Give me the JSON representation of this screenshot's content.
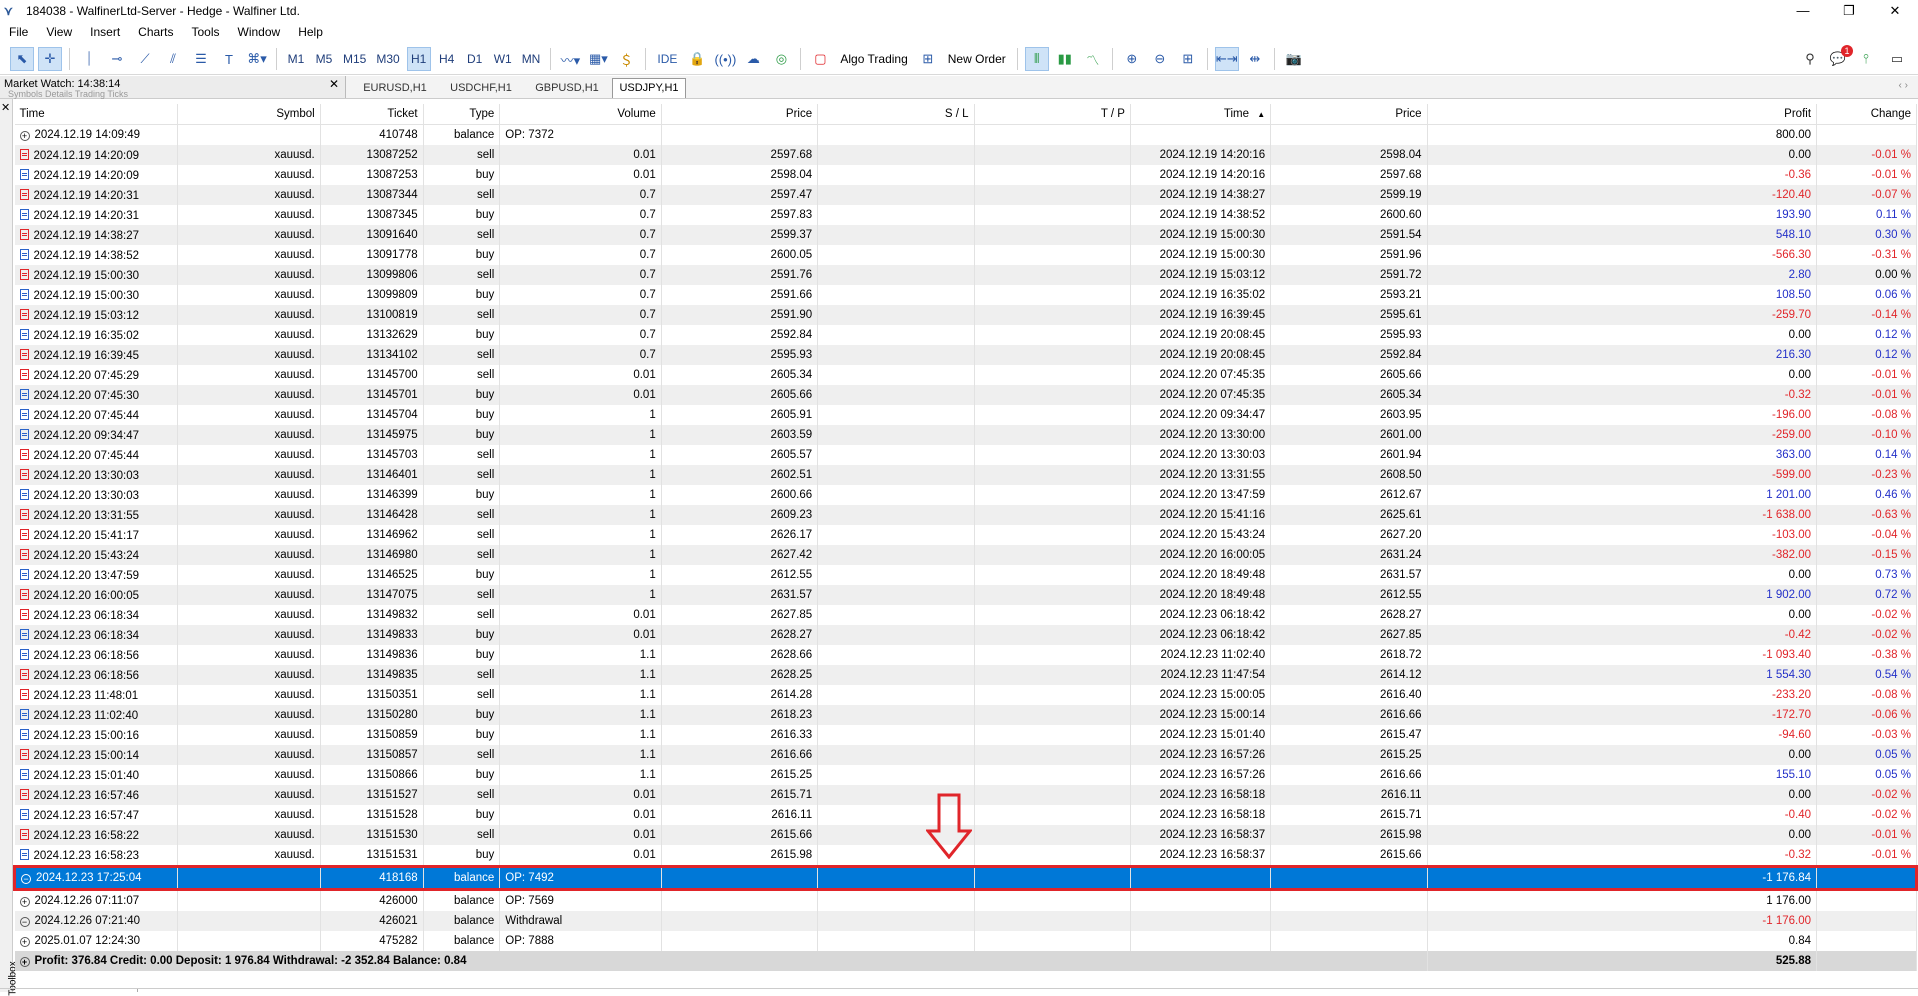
{
  "window": {
    "title": "184038 - WalfinerLtd-Server - Hedge - Walfiner Ltd."
  },
  "menu": [
    "File",
    "View",
    "Insert",
    "Charts",
    "Tools",
    "Window",
    "Help"
  ],
  "toolbar": {
    "timeframes": [
      "M1",
      "M5",
      "M15",
      "M30",
      "H1",
      "H4",
      "D1",
      "W1",
      "MN"
    ],
    "active_timeframe": "H1",
    "ide_label": "IDE",
    "algo_label": "Algo Trading",
    "neworder_label": "New Order",
    "notification_count": "1"
  },
  "market_watch": {
    "label": "Market Watch: 14:38:14",
    "ghost_tabs": "Symbols   Details   Trading   Ticks"
  },
  "chart_tabs": [
    "EURUSD,H1",
    "USDCHF,H1",
    "GBPUSD,H1",
    "USDJPY,H1"
  ],
  "active_chart_tab": "USDJPY,H1",
  "side_label": "Toolbox",
  "columns": [
    "Time",
    "Symbol",
    "Ticket",
    "Type",
    "Volume",
    "Price",
    "S / L",
    "T / P",
    "Time",
    "Price",
    "Profit",
    "Change"
  ],
  "rows": [
    {
      "kind": "balance",
      "time": "2024.12.19 14:09:49",
      "symbol": "",
      "ticket": "410748",
      "type": "balance",
      "volume": "OP: 7372",
      "price": "",
      "sl": "",
      "tp": "",
      "time2": "",
      "price2": "",
      "profit": "800.00",
      "change": ""
    },
    {
      "kind": "sell",
      "time": "2024.12.19 14:20:09",
      "symbol": "xauusd.",
      "ticket": "13087252",
      "type": "sell",
      "volume": "0.01",
      "price": "2597.68",
      "sl": "",
      "tp": "",
      "time2": "2024.12.19 14:20:16",
      "price2": "2598.04",
      "profit": "0.00",
      "change": "-0.01 %"
    },
    {
      "kind": "buy",
      "time": "2024.12.19 14:20:09",
      "symbol": "xauusd.",
      "ticket": "13087253",
      "type": "buy",
      "volume": "0.01",
      "price": "2598.04",
      "sl": "",
      "tp": "",
      "time2": "2024.12.19 14:20:16",
      "price2": "2597.68",
      "profit": "-0.36",
      "change": "-0.01 %"
    },
    {
      "kind": "sell",
      "time": "2024.12.19 14:20:31",
      "symbol": "xauusd.",
      "ticket": "13087344",
      "type": "sell",
      "volume": "0.7",
      "price": "2597.47",
      "sl": "",
      "tp": "",
      "time2": "2024.12.19 14:38:27",
      "price2": "2599.19",
      "profit": "-120.40",
      "change": "-0.07 %"
    },
    {
      "kind": "buy",
      "time": "2024.12.19 14:20:31",
      "symbol": "xauusd.",
      "ticket": "13087345",
      "type": "buy",
      "volume": "0.7",
      "price": "2597.83",
      "sl": "",
      "tp": "",
      "time2": "2024.12.19 14:38:52",
      "price2": "2600.60",
      "profit": "193.90",
      "change": "0.11 %"
    },
    {
      "kind": "sell",
      "time": "2024.12.19 14:38:27",
      "symbol": "xauusd.",
      "ticket": "13091640",
      "type": "sell",
      "volume": "0.7",
      "price": "2599.37",
      "sl": "",
      "tp": "",
      "time2": "2024.12.19 15:00:30",
      "price2": "2591.54",
      "profit": "548.10",
      "change": "0.30 %"
    },
    {
      "kind": "buy",
      "time": "2024.12.19 14:38:52",
      "symbol": "xauusd.",
      "ticket": "13091778",
      "type": "buy",
      "volume": "0.7",
      "price": "2600.05",
      "sl": "",
      "tp": "",
      "time2": "2024.12.19 15:00:30",
      "price2": "2591.96",
      "profit": "-566.30",
      "change": "-0.31 %"
    },
    {
      "kind": "sell",
      "time": "2024.12.19 15:00:30",
      "symbol": "xauusd.",
      "ticket": "13099806",
      "type": "sell",
      "volume": "0.7",
      "price": "2591.76",
      "sl": "",
      "tp": "",
      "time2": "2024.12.19 15:03:12",
      "price2": "2591.72",
      "profit": "2.80",
      "change": "0.00 %"
    },
    {
      "kind": "buy",
      "time": "2024.12.19 15:00:30",
      "symbol": "xauusd.",
      "ticket": "13099809",
      "type": "buy",
      "volume": "0.7",
      "price": "2591.66",
      "sl": "",
      "tp": "",
      "time2": "2024.12.19 16:35:02",
      "price2": "2593.21",
      "profit": "108.50",
      "change": "0.06 %"
    },
    {
      "kind": "sell",
      "time": "2024.12.19 15:03:12",
      "symbol": "xauusd.",
      "ticket": "13100819",
      "type": "sell",
      "volume": "0.7",
      "price": "2591.90",
      "sl": "",
      "tp": "",
      "time2": "2024.12.19 16:39:45",
      "price2": "2595.61",
      "profit": "-259.70",
      "change": "-0.14 %"
    },
    {
      "kind": "buy",
      "time": "2024.12.19 16:35:02",
      "symbol": "xauusd.",
      "ticket": "13132629",
      "type": "buy",
      "volume": "0.7",
      "price": "2592.84",
      "sl": "",
      "tp": "",
      "time2": "2024.12.19 20:08:45",
      "price2": "2595.93",
      "profit": "0.00",
      "change": "0.12 %"
    },
    {
      "kind": "sell",
      "time": "2024.12.19 16:39:45",
      "symbol": "xauusd.",
      "ticket": "13134102",
      "type": "sell",
      "volume": "0.7",
      "price": "2595.93",
      "sl": "",
      "tp": "",
      "time2": "2024.12.19 20:08:45",
      "price2": "2592.84",
      "profit": "216.30",
      "change": "0.12 %"
    },
    {
      "kind": "sell",
      "time": "2024.12.20 07:45:29",
      "symbol": "xauusd.",
      "ticket": "13145700",
      "type": "sell",
      "volume": "0.01",
      "price": "2605.34",
      "sl": "",
      "tp": "",
      "time2": "2024.12.20 07:45:35",
      "price2": "2605.66",
      "profit": "0.00",
      "change": "-0.01 %"
    },
    {
      "kind": "buy",
      "time": "2024.12.20 07:45:30",
      "symbol": "xauusd.",
      "ticket": "13145701",
      "type": "buy",
      "volume": "0.01",
      "price": "2605.66",
      "sl": "",
      "tp": "",
      "time2": "2024.12.20 07:45:35",
      "price2": "2605.34",
      "profit": "-0.32",
      "change": "-0.01 %"
    },
    {
      "kind": "buy",
      "time": "2024.12.20 07:45:44",
      "symbol": "xauusd.",
      "ticket": "13145704",
      "type": "buy",
      "volume": "1",
      "price": "2605.91",
      "sl": "",
      "tp": "",
      "time2": "2024.12.20 09:34:47",
      "price2": "2603.95",
      "profit": "-196.00",
      "change": "-0.08 %"
    },
    {
      "kind": "buy",
      "time": "2024.12.20 09:34:47",
      "symbol": "xauusd.",
      "ticket": "13145975",
      "type": "buy",
      "volume": "1",
      "price": "2603.59",
      "sl": "",
      "tp": "",
      "time2": "2024.12.20 13:30:00",
      "price2": "2601.00",
      "profit": "-259.00",
      "change": "-0.10 %"
    },
    {
      "kind": "sell",
      "time": "2024.12.20 07:45:44",
      "symbol": "xauusd.",
      "ticket": "13145703",
      "type": "sell",
      "volume": "1",
      "price": "2605.57",
      "sl": "",
      "tp": "",
      "time2": "2024.12.20 13:30:03",
      "price2": "2601.94",
      "profit": "363.00",
      "change": "0.14 %"
    },
    {
      "kind": "sell",
      "time": "2024.12.20 13:30:03",
      "symbol": "xauusd.",
      "ticket": "13146401",
      "type": "sell",
      "volume": "1",
      "price": "2602.51",
      "sl": "",
      "tp": "",
      "time2": "2024.12.20 13:31:55",
      "price2": "2608.50",
      "profit": "-599.00",
      "change": "-0.23 %"
    },
    {
      "kind": "buy",
      "time": "2024.12.20 13:30:03",
      "symbol": "xauusd.",
      "ticket": "13146399",
      "type": "buy",
      "volume": "1",
      "price": "2600.66",
      "sl": "",
      "tp": "",
      "time2": "2024.12.20 13:47:59",
      "price2": "2612.67",
      "profit": "1 201.00",
      "change": "0.46 %"
    },
    {
      "kind": "sell",
      "time": "2024.12.20 13:31:55",
      "symbol": "xauusd.",
      "ticket": "13146428",
      "type": "sell",
      "volume": "1",
      "price": "2609.23",
      "sl": "",
      "tp": "",
      "time2": "2024.12.20 15:41:16",
      "price2": "2625.61",
      "profit": "-1 638.00",
      "change": "-0.63 %"
    },
    {
      "kind": "sell",
      "time": "2024.12.20 15:41:17",
      "symbol": "xauusd.",
      "ticket": "13146962",
      "type": "sell",
      "volume": "1",
      "price": "2626.17",
      "sl": "",
      "tp": "",
      "time2": "2024.12.20 15:43:24",
      "price2": "2627.20",
      "profit": "-103.00",
      "change": "-0.04 %"
    },
    {
      "kind": "sell",
      "time": "2024.12.20 15:43:24",
      "symbol": "xauusd.",
      "ticket": "13146980",
      "type": "sell",
      "volume": "1",
      "price": "2627.42",
      "sl": "",
      "tp": "",
      "time2": "2024.12.20 16:00:05",
      "price2": "2631.24",
      "profit": "-382.00",
      "change": "-0.15 %"
    },
    {
      "kind": "buy",
      "time": "2024.12.20 13:47:59",
      "symbol": "xauusd.",
      "ticket": "13146525",
      "type": "buy",
      "volume": "1",
      "price": "2612.55",
      "sl": "",
      "tp": "",
      "time2": "2024.12.20 18:49:48",
      "price2": "2631.57",
      "profit": "0.00",
      "change": "0.73 %"
    },
    {
      "kind": "sell",
      "time": "2024.12.20 16:00:05",
      "symbol": "xauusd.",
      "ticket": "13147075",
      "type": "sell",
      "volume": "1",
      "price": "2631.57",
      "sl": "",
      "tp": "",
      "time2": "2024.12.20 18:49:48",
      "price2": "2612.55",
      "profit": "1 902.00",
      "change": "0.72 %"
    },
    {
      "kind": "sell",
      "time": "2024.12.23 06:18:34",
      "symbol": "xauusd.",
      "ticket": "13149832",
      "type": "sell",
      "volume": "0.01",
      "price": "2627.85",
      "sl": "",
      "tp": "",
      "time2": "2024.12.23 06:18:42",
      "price2": "2628.27",
      "profit": "0.00",
      "change": "-0.02 %"
    },
    {
      "kind": "buy",
      "time": "2024.12.23 06:18:34",
      "symbol": "xauusd.",
      "ticket": "13149833",
      "type": "buy",
      "volume": "0.01",
      "price": "2628.27",
      "sl": "",
      "tp": "",
      "time2": "2024.12.23 06:18:42",
      "price2": "2627.85",
      "profit": "-0.42",
      "change": "-0.02 %"
    },
    {
      "kind": "buy",
      "time": "2024.12.23 06:18:56",
      "symbol": "xauusd.",
      "ticket": "13149836",
      "type": "buy",
      "volume": "1.1",
      "price": "2628.66",
      "sl": "",
      "tp": "",
      "time2": "2024.12.23 11:02:40",
      "price2": "2618.72",
      "profit": "-1 093.40",
      "change": "-0.38 %"
    },
    {
      "kind": "sell",
      "time": "2024.12.23 06:18:56",
      "symbol": "xauusd.",
      "ticket": "13149835",
      "type": "sell",
      "volume": "1.1",
      "price": "2628.25",
      "sl": "",
      "tp": "",
      "time2": "2024.12.23 11:47:54",
      "price2": "2614.12",
      "profit": "1 554.30",
      "change": "0.54 %"
    },
    {
      "kind": "sell",
      "time": "2024.12.23 11:48:01",
      "symbol": "xauusd.",
      "ticket": "13150351",
      "type": "sell",
      "volume": "1.1",
      "price": "2614.28",
      "sl": "",
      "tp": "",
      "time2": "2024.12.23 15:00:05",
      "price2": "2616.40",
      "profit": "-233.20",
      "change": "-0.08 %"
    },
    {
      "kind": "buy",
      "time": "2024.12.23 11:02:40",
      "symbol": "xauusd.",
      "ticket": "13150280",
      "type": "buy",
      "volume": "1.1",
      "price": "2618.23",
      "sl": "",
      "tp": "",
      "time2": "2024.12.23 15:00:14",
      "price2": "2616.66",
      "profit": "-172.70",
      "change": "-0.06 %"
    },
    {
      "kind": "buy",
      "time": "2024.12.23 15:00:16",
      "symbol": "xauusd.",
      "ticket": "13150859",
      "type": "buy",
      "volume": "1.1",
      "price": "2616.33",
      "sl": "",
      "tp": "",
      "time2": "2024.12.23 15:01:40",
      "price2": "2615.47",
      "profit": "-94.60",
      "change": "-0.03 %"
    },
    {
      "kind": "sell",
      "time": "2024.12.23 15:00:14",
      "symbol": "xauusd.",
      "ticket": "13150857",
      "type": "sell",
      "volume": "1.1",
      "price": "2616.66",
      "sl": "",
      "tp": "",
      "time2": "2024.12.23 16:57:26",
      "price2": "2615.25",
      "profit": "0.00",
      "change": "0.05 %"
    },
    {
      "kind": "buy",
      "time": "2024.12.23 15:01:40",
      "symbol": "xauusd.",
      "ticket": "13150866",
      "type": "buy",
      "volume": "1.1",
      "price": "2615.25",
      "sl": "",
      "tp": "",
      "time2": "2024.12.23 16:57:26",
      "price2": "2616.66",
      "profit": "155.10",
      "change": "0.05 %"
    },
    {
      "kind": "sell",
      "time": "2024.12.23 16:57:46",
      "symbol": "xauusd.",
      "ticket": "13151527",
      "type": "sell",
      "volume": "0.01",
      "price": "2615.71",
      "sl": "",
      "tp": "",
      "time2": "2024.12.23 16:58:18",
      "price2": "2616.11",
      "profit": "0.00",
      "change": "-0.02 %"
    },
    {
      "kind": "buy",
      "time": "2024.12.23 16:57:47",
      "symbol": "xauusd.",
      "ticket": "13151528",
      "type": "buy",
      "volume": "0.01",
      "price": "2616.11",
      "sl": "",
      "tp": "",
      "time2": "2024.12.23 16:58:18",
      "price2": "2615.71",
      "profit": "-0.40",
      "change": "-0.02 %"
    },
    {
      "kind": "sell",
      "time": "2024.12.23 16:58:22",
      "symbol": "xauusd.",
      "ticket": "13151530",
      "type": "sell",
      "volume": "0.01",
      "price": "2615.66",
      "sl": "",
      "tp": "",
      "time2": "2024.12.23 16:58:37",
      "price2": "2615.98",
      "profit": "0.00",
      "change": "-0.01 %"
    },
    {
      "kind": "buy",
      "time": "2024.12.23 16:58:23",
      "symbol": "xauusd.",
      "ticket": "13151531",
      "type": "buy",
      "volume": "0.01",
      "price": "2615.98",
      "sl": "",
      "tp": "",
      "time2": "2024.12.23 16:58:37",
      "price2": "2615.66",
      "profit": "-0.32",
      "change": "-0.01 %"
    },
    {
      "kind": "balance-minus",
      "time": "2024.12.23 17:25:04",
      "symbol": "",
      "ticket": "418168",
      "type": "balance",
      "volume": "OP: 7492",
      "price": "",
      "sl": "",
      "tp": "",
      "time2": "",
      "price2": "",
      "profit": "-1 176.84",
      "change": "",
      "selected": true
    },
    {
      "kind": "balance",
      "time": "2024.12.26 07:11:07",
      "symbol": "",
      "ticket": "426000",
      "type": "balance",
      "volume": "OP: 7569",
      "price": "",
      "sl": "",
      "tp": "",
      "time2": "",
      "price2": "",
      "profit": "1 176.00",
      "change": ""
    },
    {
      "kind": "balance-minus",
      "time": "2024.12.26 07:21:40",
      "symbol": "",
      "ticket": "426021",
      "type": "balance",
      "volume": "Withdrawal",
      "price": "",
      "sl": "",
      "tp": "",
      "time2": "",
      "price2": "",
      "profit": "-1 176.00",
      "change": ""
    },
    {
      "kind": "balance",
      "time": "2025.01.07 12:24:30",
      "symbol": "",
      "ticket": "475282",
      "type": "balance",
      "volume": "OP: 7888",
      "price": "",
      "sl": "",
      "tp": "",
      "time2": "",
      "price2": "",
      "profit": "0.84",
      "change": ""
    }
  ],
  "summary": {
    "text": "Profit: 376.84  Credit: 0.00  Deposit: 1 976.84  Withdrawal: -2 352.84  Balance: 0.84",
    "profit": "525.88"
  },
  "colors": {
    "negative": "#e0252a",
    "positive": "#2330c8",
    "selection": "#0078d7",
    "highlight_border": "#e0252a"
  }
}
